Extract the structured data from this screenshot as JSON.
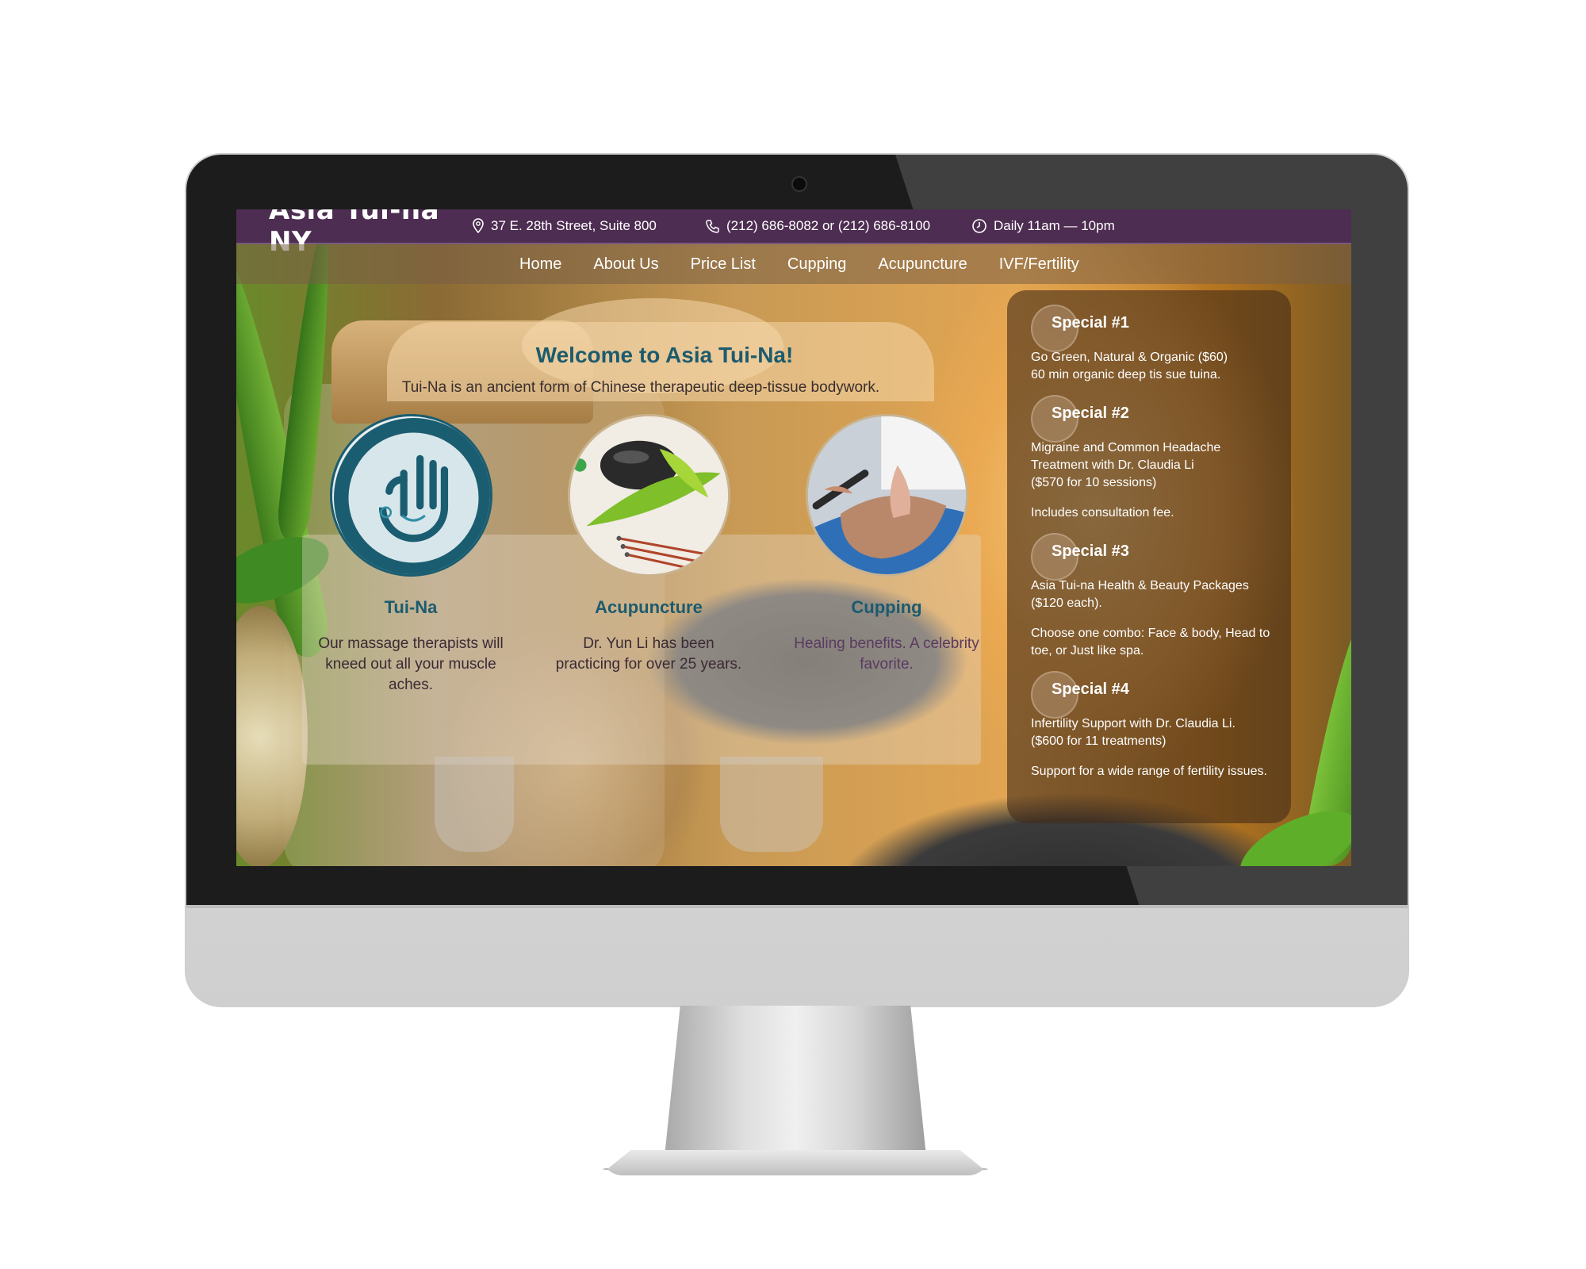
{
  "header": {
    "brand": "Asia Tui-na NY",
    "address": "37 E. 28th Street, Suite 800",
    "phone": "(212) 686-8082 or (212) 686-8100",
    "hours": "Daily 11am — 10pm"
  },
  "nav": [
    {
      "label": "Home"
    },
    {
      "label": "About Us"
    },
    {
      "label": "Price List"
    },
    {
      "label": "Cupping"
    },
    {
      "label": "Acupuncture"
    },
    {
      "label": "IVF/Fertility"
    }
  ],
  "welcome": {
    "title": "Welcome to Asia Tui-Na!",
    "subtitle": "Tui-Na is an ancient form of Chinese therapeutic deep-tissue bodywork."
  },
  "services": [
    {
      "title": "Tui-Na",
      "text": "Our massage therapists will kneed out all your muscle aches."
    },
    {
      "title": "Acupuncture",
      "text": "Dr. Yun Li has been practicing for over 25 years."
    },
    {
      "title": "Cupping",
      "text": "Healing benefits. A celebrity favorite."
    }
  ],
  "specials": [
    {
      "title": "Special #1",
      "lines": [
        "Go Green, Natural & Organic ($60)",
        "60 min organic deep tis sue tuina."
      ],
      "note": ""
    },
    {
      "title": "Special #2",
      "lines": [
        "Migraine and Common Headache",
        "Treatment with Dr. Claudia Li",
        "($570 for 10 sessions)"
      ],
      "note": "Includes consultation fee."
    },
    {
      "title": "Special #3",
      "lines": [
        "Asia Tui-na Health & Beauty Packages",
        "($120 each)."
      ],
      "note": "Choose one combo: Face & body, Head to toe, or Just like spa."
    },
    {
      "title": "Special #4",
      "lines": [
        "Infertility Support with Dr. Claudia Li.",
        "($600 for 11 treatments)"
      ],
      "note": "Support for a wide range of fertility issues."
    }
  ],
  "colors": {
    "topbar": "#4e2d52",
    "heading_teal": "#1c5b6e",
    "logo_teal": "#1a5d70"
  }
}
